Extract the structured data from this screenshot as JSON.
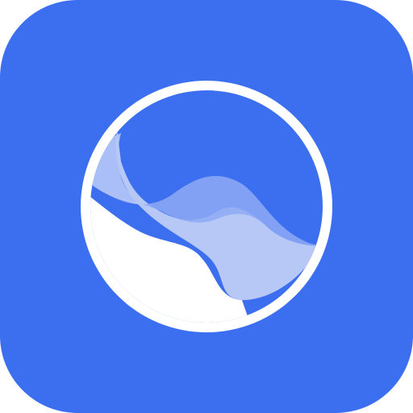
{
  "app_icon": {
    "icon": "wave-in-circle-icon",
    "colors": {
      "tile_background": "#3B6FEF",
      "ring": "#FFFFFF",
      "circle_fill": "#3B6FEF",
      "wave_light": "#B7C8F7",
      "wave_mid": "#8FAAF5",
      "wave_base": "#FFFFFF"
    }
  }
}
